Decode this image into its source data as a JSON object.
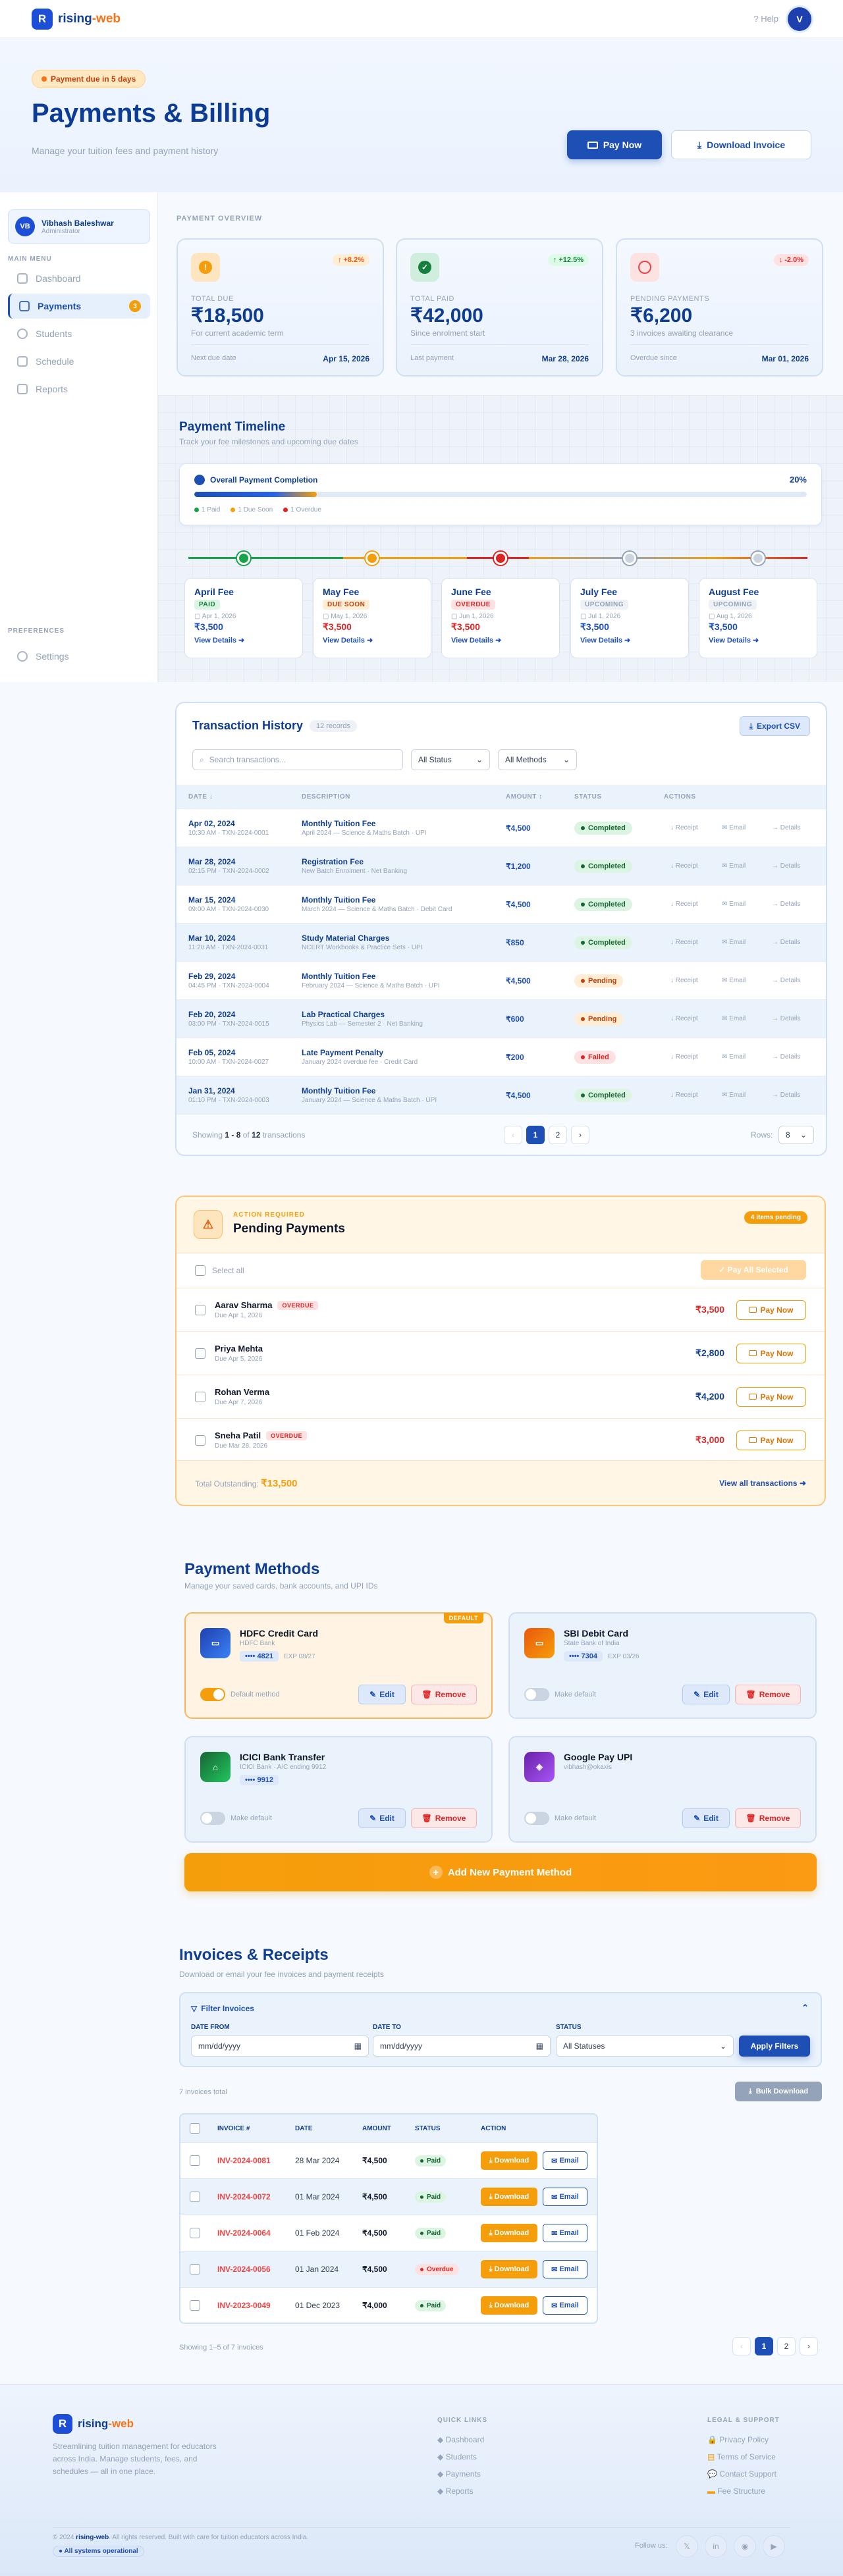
{
  "app": {
    "logo_letter": "R",
    "name_part1": "rising",
    "name_part2": "-web",
    "help": "? Help",
    "avatar": "V"
  },
  "hero": {
    "alert": "Payment due in 5 days",
    "title": "Payments & Billing",
    "subtitle": "Manage your tuition fees and payment history",
    "pay_now": "Pay Now",
    "download_invoice": "Download Invoice"
  },
  "sidebar": {
    "user": {
      "initials": "VB",
      "name": "Vibhash Baleshwar",
      "role": "Administrator"
    },
    "main_menu": "MAIN MENU",
    "items": [
      {
        "label": "Dashboard"
      },
      {
        "label": "Payments",
        "badge": "3"
      },
      {
        "label": "Students"
      },
      {
        "label": "Schedule"
      },
      {
        "label": "Reports"
      }
    ],
    "preferences": "PREFERENCES",
    "settings": "Settings"
  },
  "overview": {
    "heading": "PAYMENT OVERVIEW",
    "cards": [
      {
        "trend": "↑ +8.2%",
        "label": "TOTAL DUE",
        "value": "₹18,500",
        "sub": "For current academic term",
        "foot_label": "Next due date",
        "foot_value": "Apr 15, 2026"
      },
      {
        "trend": "↑ +12.5%",
        "label": "TOTAL PAID",
        "value": "₹42,000",
        "sub": "Since enrolment start",
        "foot_label": "Last payment",
        "foot_value": "Mar 28, 2026"
      },
      {
        "trend": "↓ -2.0%",
        "label": "PENDING PAYMENTS",
        "value": "₹6,200",
        "sub": "3 invoices awaiting clearance",
        "foot_label": "Overdue since",
        "foot_value": "Mar 01, 2026"
      }
    ]
  },
  "timeline": {
    "title": "Payment Timeline",
    "subtitle": "Track your fee milestones and upcoming due dates",
    "completion_label": "Overall Payment Completion",
    "completion_pct": "20%",
    "completion_value": 0.2,
    "legend": [
      "1 Paid",
      "1 Due Soon",
      "1 Overdue"
    ],
    "fees": [
      {
        "name": "April Fee",
        "status": "PAID",
        "date": "Apr 1, 2026",
        "amount": "₹3,500",
        "link": "View Details ➜"
      },
      {
        "name": "May Fee",
        "status": "DUE SOON",
        "date": "May 1, 2026",
        "amount": "₹3,500",
        "link": "View Details ➜"
      },
      {
        "name": "June Fee",
        "status": "OVERDUE",
        "date": "Jun 1, 2026",
        "amount": "₹3,500",
        "link": "View Details ➜"
      },
      {
        "name": "July Fee",
        "status": "UPCOMING",
        "date": "Jul 1, 2026",
        "amount": "₹3,500",
        "link": "View Details ➜"
      },
      {
        "name": "August Fee",
        "status": "UPCOMING",
        "date": "Aug 1, 2026",
        "amount": "₹3,500",
        "link": "View Details ➜"
      }
    ]
  },
  "transactions": {
    "title": "Transaction History",
    "count": "12 records",
    "export": "Export CSV",
    "search_placeholder": "Search transactions...",
    "filter_status": "All Status",
    "filter_method": "All Methods",
    "columns": [
      "DATE ↓",
      "DESCRIPTION",
      "AMOUNT ↕",
      "STATUS",
      "ACTIONS"
    ],
    "rows": [
      {
        "date": "Apr 02, 2024",
        "meta": "10:30 AM · TXN-2024-0001",
        "desc": "Monthly Tuition Fee",
        "sub": "April 2024 — Science & Maths Batch · UPI",
        "amount": "₹4,500",
        "status": "Completed"
      },
      {
        "date": "Mar 28, 2024",
        "meta": "02:15 PM · TXN-2024-0002",
        "desc": "Registration Fee",
        "sub": "New Batch Enrolment · Net Banking",
        "amount": "₹1,200",
        "status": "Completed"
      },
      {
        "date": "Mar 15, 2024",
        "meta": "09:00 AM · TXN-2024-0030",
        "desc": "Monthly Tuition Fee",
        "sub": "March 2024 — Science & Maths Batch · Debit Card",
        "amount": "₹4,500",
        "status": "Completed"
      },
      {
        "date": "Mar 10, 2024",
        "meta": "11:20 AM · TXN-2024-0031",
        "desc": "Study Material Charges",
        "sub": "NCERT Workbooks & Practice Sets · UPI",
        "amount": "₹850",
        "status": "Completed"
      },
      {
        "date": "Feb 29, 2024",
        "meta": "04:45 PM · TXN-2024-0004",
        "desc": "Monthly Tuition Fee",
        "sub": "February 2024 — Science & Maths Batch · UPI",
        "amount": "₹4,500",
        "status": "Pending"
      },
      {
        "date": "Feb 20, 2024",
        "meta": "03:00 PM · TXN-2024-0015",
        "desc": "Lab Practical Charges",
        "sub": "Physics Lab — Semester 2 · Net Banking",
        "amount": "₹600",
        "status": "Pending"
      },
      {
        "date": "Feb 05, 2024",
        "meta": "10:00 AM · TXN-2024-0027",
        "desc": "Late Payment Penalty",
        "sub": "January 2024 overdue fee · Credit Card",
        "amount": "₹200",
        "status": "Failed"
      },
      {
        "date": "Jan 31, 2024",
        "meta": "01:10 PM · TXN-2024-0003",
        "desc": "Monthly Tuition Fee",
        "sub": "January 2024 — Science & Maths Batch · UPI",
        "amount": "₹4,500",
        "status": "Completed"
      }
    ],
    "actions": [
      "↓ Receipt",
      "✉ Email",
      "→ Details"
    ],
    "showing_pre": "Showing ",
    "showing_range": "1 - 8",
    "showing_mid": " of ",
    "showing_total": "12",
    "showing_post": " transactions",
    "pages": [
      "‹",
      "1",
      "2",
      "›"
    ],
    "rows_label": "Rows:",
    "rows_value": "8"
  },
  "pending": {
    "kicker": "ACTION REQUIRED",
    "title": "Pending Payments",
    "badge": "4 items pending",
    "select_all": "Select all",
    "pay_all": "✓ Pay All Selected",
    "items": [
      {
        "name": "Aarav Sharma",
        "flag": "OVERDUE",
        "due": "Due Apr 1, 2026",
        "amount": "₹3,500"
      },
      {
        "name": "Priya Mehta",
        "flag": "",
        "due": "Due Apr 5, 2026",
        "amount": "₹2,800"
      },
      {
        "name": "Rohan Verma",
        "flag": "",
        "due": "Due Apr 7, 2026",
        "amount": "₹4,200"
      },
      {
        "name": "Sneha Patil",
        "flag": "OVERDUE",
        "due": "Due Mar 28, 2026",
        "amount": "₹3,000"
      }
    ],
    "pay_label": "Pay Now",
    "total_label": "Total Outstanding:",
    "total_value": "₹13,500",
    "view_all": "View all transactions ➜"
  },
  "methods": {
    "title": "Payment Methods",
    "subtitle": "Manage your saved cards, bank accounts, and UPI IDs",
    "cards": [
      {
        "name": "HDFC Credit Card",
        "bank": "HDFC Bank",
        "number": "•••• 4821",
        "exp": "EXP 08/27",
        "default_text": "Default method",
        "badge": "DEFAULT"
      },
      {
        "name": "SBI Debit Card",
        "bank": "State Bank of India",
        "number": "•••• 7304",
        "exp": "EXP 03/26",
        "default_text": "Make default"
      },
      {
        "name": "ICICI Bank Transfer",
        "bank": "ICICI Bank · A/C ending 9912",
        "number": "•••• 9912",
        "default_text": "Make default"
      },
      {
        "name": "Google Pay UPI",
        "bank": "vibhash@okaxis",
        "default_text": "Make default"
      }
    ],
    "edit": "Edit",
    "remove": "Remove",
    "add": "Add New Payment Method"
  },
  "invoices": {
    "title": "Invoices & Receipts",
    "subtitle": "Download or email your fee invoices and payment receipts",
    "filter_title": "Filter Invoices",
    "date_from_label": "DATE FROM",
    "date_to_label": "DATE TO",
    "status_label": "STATUS",
    "date_placeholder": "mm/dd/yyyy",
    "status_value": "All Statuses",
    "apply": "Apply Filters",
    "total": "7 invoices total",
    "bulk": "Bulk Download",
    "columns": [
      "INVOICE #",
      "DATE",
      "AMOUNT",
      "STATUS",
      "ACTION"
    ],
    "rows": [
      {
        "id": "INV-2024-0081",
        "date": "28 Mar 2024",
        "amount": "₹4,500",
        "status": "Paid"
      },
      {
        "id": "INV-2024-0072",
        "date": "01 Mar 2024",
        "amount": "₹4,500",
        "status": "Paid"
      },
      {
        "id": "INV-2024-0064",
        "date": "01 Feb 2024",
        "amount": "₹4,500",
        "status": "Paid"
      },
      {
        "id": "INV-2024-0056",
        "date": "01 Jan 2024",
        "amount": "₹4,500",
        "status": "Overdue"
      },
      {
        "id": "INV-2023-0049",
        "date": "01 Dec 2023",
        "amount": "₹4,000",
        "status": "Paid"
      }
    ],
    "download": "Download",
    "email": "Email",
    "showing": "Showing 1–5 of 7 invoices",
    "pages": [
      "‹",
      "1",
      "2",
      "›"
    ]
  },
  "footer": {
    "tagline": "Streamlining tuition management for educators across India. Manage students, fees, and schedules — all in one place.",
    "quick_title": "QUICK LINKS",
    "quick": [
      "Dashboard",
      "Students",
      "Payments",
      "Reports"
    ],
    "legal_title": "LEGAL & SUPPORT",
    "legal": [
      "Privacy Policy",
      "Terms of Service",
      "Contact Support",
      "Fee Structure"
    ],
    "copyright_pre": "© 2024 ",
    "copyright_brand": "rising-web",
    "copyright_post": ". All rights reserved. Built with care for tuition educators across India.",
    "system": "● All systems operational",
    "follow": "Follow us:",
    "social": [
      "𝕏",
      "in",
      "◉",
      "▶"
    ]
  },
  "colors": {
    "primary": "#1e4fb4",
    "navy": "#0f3d91",
    "accent": "#f97316",
    "warning": "#f59e0b",
    "success": "#16a34a",
    "danger": "#dc2626"
  }
}
